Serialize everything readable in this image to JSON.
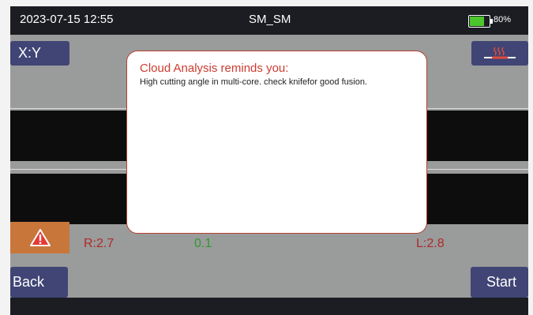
{
  "status_bar": {
    "datetime": "2023-07-15 12:55",
    "mode": "SM_SM",
    "battery": "80%"
  },
  "buttons": {
    "xy": "X:Y",
    "back": "Back",
    "start": "Start"
  },
  "measurements": {
    "right": "R:2.7",
    "center": "0.1",
    "left": "L:2.8"
  },
  "dialog": {
    "title": "Cloud Analysis reminds you:",
    "message": "High cutting angle in multi-core. check knifefor good fusion."
  },
  "icons": {
    "heater": "heater-icon",
    "warning": "warning-icon",
    "battery": "battery-icon"
  },
  "colors": {
    "accent_red": "#cc3b2f",
    "ok_green": "#2f9a2f",
    "button": "#404575",
    "warning": "#c8763a",
    "battery": "#4cc62d"
  }
}
